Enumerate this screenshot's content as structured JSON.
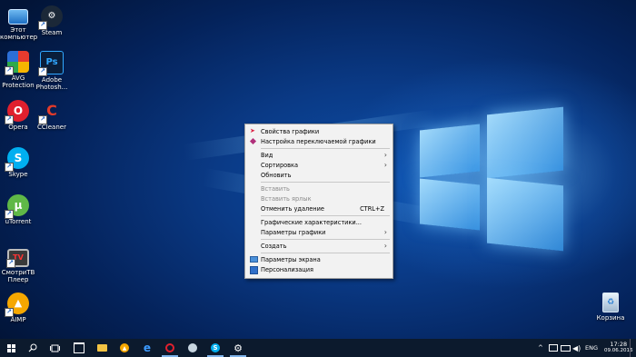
{
  "desktop": {
    "icons": [
      {
        "label": "Этот компьютер",
        "icon": "computer-icon"
      },
      {
        "label": "Steam",
        "icon": "steam-icon"
      },
      {
        "label": "AVG Protection",
        "icon": "avg-icon"
      },
      {
        "label": "Adobe Photosh...",
        "icon": "photoshop-icon"
      },
      {
        "label": "Opera",
        "icon": "opera-icon"
      },
      {
        "label": "CCleaner",
        "icon": "ccleaner-icon"
      },
      {
        "label": "Skype",
        "icon": "skype-icon"
      },
      {
        "label": "uTorrent",
        "icon": "utorrent-icon"
      },
      {
        "label": "СмотриТВ Плеер",
        "icon": "tv-player-icon"
      },
      {
        "label": "AIMP",
        "icon": "aimp-icon"
      },
      {
        "label": "Корзина",
        "icon": "recycle-bin-icon"
      }
    ]
  },
  "context_menu": {
    "items": [
      {
        "label": "Свойства графики",
        "icon": "intel-graphics-icon"
      },
      {
        "label": "Настройка переключаемой графики",
        "icon": "amd-switchable-icon"
      },
      {
        "label": "Вид"
      },
      {
        "label": "Сортировка"
      },
      {
        "label": "Обновить"
      },
      {
        "label": "Вставить"
      },
      {
        "label": "Вставить ярлык"
      },
      {
        "label": "Отменить удаление",
        "shortcut": "CTRL+Z"
      },
      {
        "label": "Графические характеристики..."
      },
      {
        "label": "Параметры графики"
      },
      {
        "label": "Создать"
      },
      {
        "label": "Параметры экрана",
        "icon": "display-settings-icon"
      },
      {
        "label": "Персонализация",
        "icon": "personalization-icon"
      }
    ]
  },
  "taskbar": {
    "language": "ENG",
    "time": "17:28",
    "date": "09.06.2016"
  },
  "colors": {
    "taskbar_bg": "#0c1a2d",
    "menu_bg": "#f2f2f2",
    "accent": "#7fb3ea"
  }
}
